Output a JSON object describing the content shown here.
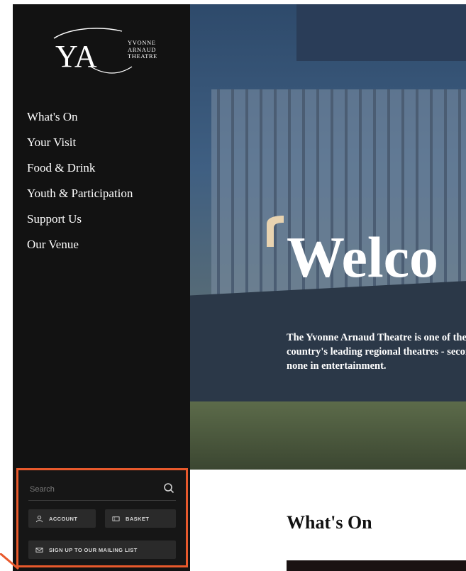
{
  "brand": {
    "monogram": "YA",
    "name_lines": [
      "YVONNE",
      "ARNAUD",
      "THEATRE"
    ]
  },
  "nav": {
    "items": [
      {
        "label": "What's On"
      },
      {
        "label": "Your Visit"
      },
      {
        "label": "Food & Drink"
      },
      {
        "label": "Youth & Participation"
      },
      {
        "label": "Support Us"
      },
      {
        "label": "Our Venue"
      }
    ]
  },
  "utility": {
    "search": {
      "placeholder": "Search",
      "icon": "search-icon"
    },
    "account_label": "ACCOUNT",
    "basket_label": "BASKET",
    "mailing_label": "SIGN UP TO OUR MAILING LIST",
    "highlight_color": "#e8592c"
  },
  "hero": {
    "title": "Welco",
    "text": "The Yvonne Arnaud Theatre is one of the country's leading regional theatres - second to none in entertainment."
  },
  "whats_on": {
    "title": "What's On"
  },
  "colors": {
    "sidebar_bg": "#121212",
    "accent": "#e8592c",
    "quote_mark": "#e8d3b0"
  }
}
